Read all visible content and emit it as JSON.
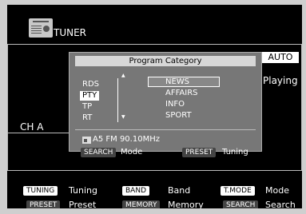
{
  "header": {
    "source_title": "TUNER",
    "icon": "radio-icon"
  },
  "status": {
    "auto_badge": "AUTO",
    "status_text": "Playing",
    "channel_label": "CH A"
  },
  "popup": {
    "title": "Program Category",
    "categories": [
      "RDS",
      "PTY",
      "TP",
      "RT"
    ],
    "selected_category": "PTY",
    "programs": [
      "NEWS",
      "AFFAIRS",
      "INFO",
      "SPORT"
    ],
    "selected_program": "NEWS",
    "station": "A5 FM 90.10MHz",
    "hints": [
      {
        "key": "SEARCH",
        "label": "Mode"
      },
      {
        "key": "PRESET",
        "label": "Tuning"
      }
    ]
  },
  "footer": {
    "row1": [
      {
        "key": "TUNING",
        "label": "Tuning"
      },
      {
        "key": "BAND",
        "label": "Band"
      },
      {
        "key": "T.MODE",
        "label": "Mode"
      }
    ],
    "row2": [
      {
        "key": "PRESET",
        "label": "Preset"
      },
      {
        "key": "MEMORY",
        "label": "Memory"
      },
      {
        "key": "SEARCH",
        "label": "Search"
      }
    ]
  },
  "colors": {
    "screen_bg": "#000000",
    "popup_bg": "#777777",
    "bezel": "#cfcfcf"
  }
}
